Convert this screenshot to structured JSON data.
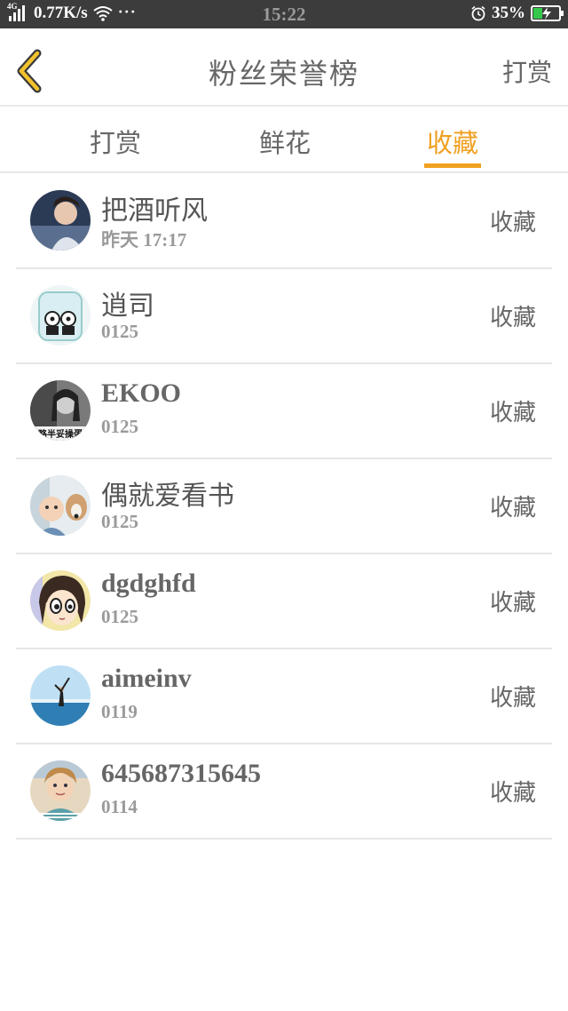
{
  "status_bar": {
    "network": "4G",
    "speed": "0.77K/s",
    "more": "···",
    "time": "15:22",
    "battery": "35%"
  },
  "header": {
    "title": "粉丝荣誉榜",
    "action": "打赏"
  },
  "tabs": [
    {
      "label": "打赏",
      "active": false
    },
    {
      "label": "鲜花",
      "active": false
    },
    {
      "label": "收藏",
      "active": true
    }
  ],
  "accent_color": "#f0a020",
  "fans": [
    {
      "name": "把酒听风",
      "time": "昨天 17:17",
      "action": "收藏",
      "avatar": "avatar-person"
    },
    {
      "name": "逍司",
      "time": "0125",
      "action": "收藏",
      "avatar": "avatar-panda-jar"
    },
    {
      "name": "EKOO",
      "time": "0125",
      "action": "收藏",
      "avatar": "avatar-girl-bw",
      "avatar_caption": "略半妥操蛋"
    },
    {
      "name": "偶就爱看书",
      "time": "0125",
      "action": "收藏",
      "avatar": "avatar-baby-dog"
    },
    {
      "name": "dgdghfd",
      "time": "0125",
      "action": "收藏",
      "avatar": "avatar-cartoon-girl"
    },
    {
      "name": "aimeinv",
      "time": "0119",
      "action": "收藏",
      "avatar": "avatar-beach"
    },
    {
      "name": "645687315645",
      "time": "0114",
      "action": "收藏",
      "avatar": "avatar-child"
    }
  ]
}
